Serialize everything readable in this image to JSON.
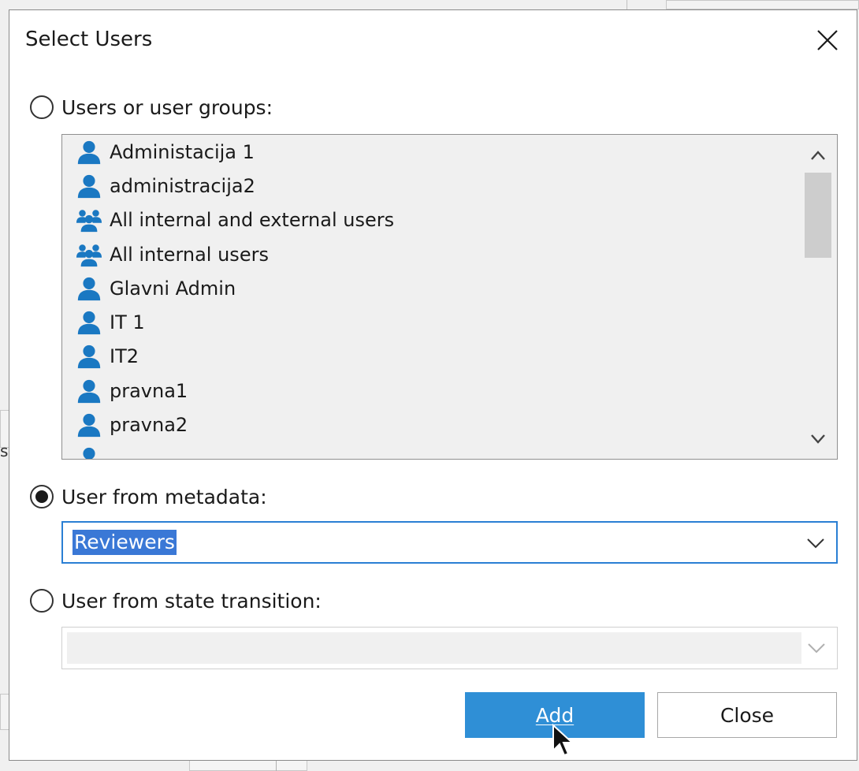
{
  "dialog": {
    "title": "Select Users",
    "close_icon": "close-icon"
  },
  "options": {
    "users_or_groups": {
      "label": "Users or user groups:",
      "selected": false
    },
    "from_metadata": {
      "label": "User from metadata:",
      "selected": true,
      "value": "Reviewers"
    },
    "from_state_transition": {
      "label": "User from state transition:",
      "selected": false,
      "value": ""
    }
  },
  "list": {
    "items": [
      {
        "label": "Administacija 1",
        "icon": "user-icon"
      },
      {
        "label": "administracija2",
        "icon": "user-icon"
      },
      {
        "label": "All internal and external users",
        "icon": "user-group-icon"
      },
      {
        "label": "All internal users",
        "icon": "user-group-icon"
      },
      {
        "label": "Glavni Admin",
        "icon": "user-icon"
      },
      {
        "label": "IT 1",
        "icon": "user-icon"
      },
      {
        "label": "IT2",
        "icon": "user-icon"
      },
      {
        "label": "pravna1",
        "icon": "user-icon"
      },
      {
        "label": "pravna2",
        "icon": "user-icon"
      },
      {
        "label": "",
        "icon": "user-icon"
      }
    ]
  },
  "buttons": {
    "add": "Add",
    "close": "Close"
  },
  "colors": {
    "accent": "#2f8fd6",
    "selection": "#3a78d6",
    "icon": "#1a78c2",
    "focus_border": "#2a7fd4"
  },
  "background": {
    "left_edge_glyph": "si"
  }
}
